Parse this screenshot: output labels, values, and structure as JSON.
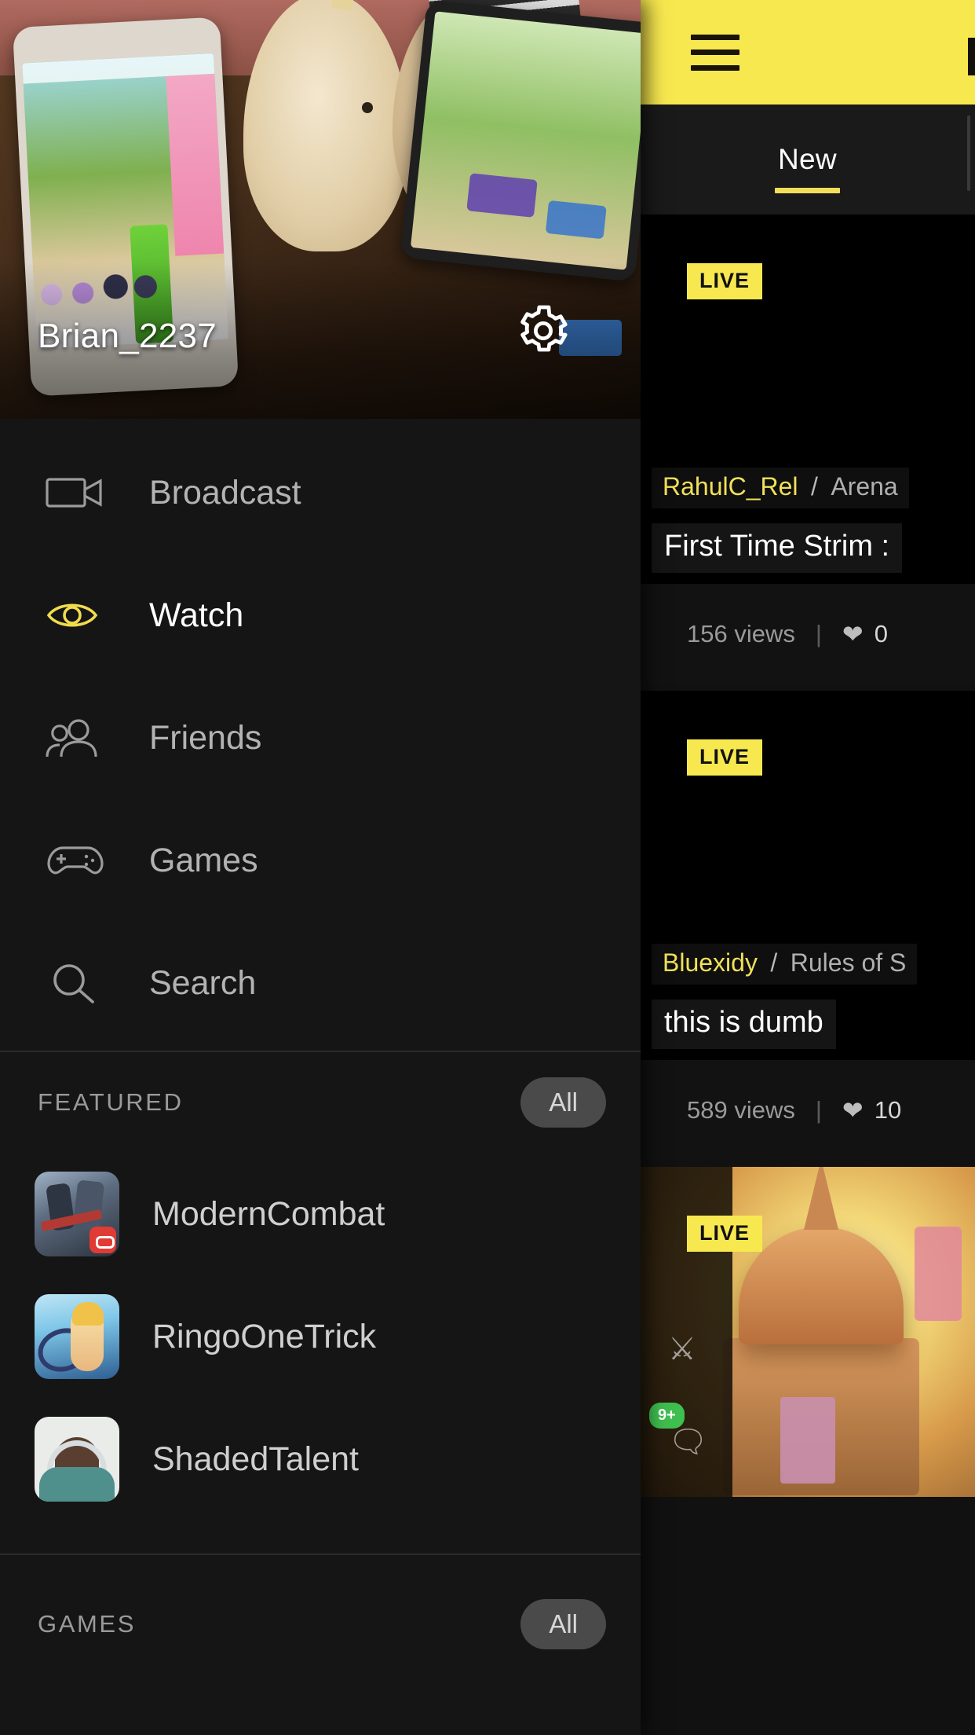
{
  "topbar": {
    "menu_icon": "hamburger-icon",
    "background": "#F8E84F"
  },
  "tabs": {
    "items": [
      {
        "label": "New",
        "active": true
      }
    ]
  },
  "drawer": {
    "profile": {
      "username": "Brian_2237",
      "settings_icon": "gear-icon"
    },
    "nav": [
      {
        "label": "Broadcast",
        "icon": "video-camera-icon",
        "active": false
      },
      {
        "label": "Watch",
        "icon": "eye-icon",
        "active": true
      },
      {
        "label": "Friends",
        "icon": "people-icon",
        "active": false
      },
      {
        "label": "Games",
        "icon": "gamepad-icon",
        "active": false
      },
      {
        "label": "Search",
        "icon": "search-icon",
        "active": false
      }
    ],
    "featured": {
      "title": "FEATURED",
      "all_label": "All",
      "items": [
        {
          "label": "ModernCombat"
        },
        {
          "label": "RingoOneTrick"
        },
        {
          "label": "ShadedTalent"
        }
      ]
    },
    "games": {
      "title": "GAMES",
      "all_label": "All"
    }
  },
  "feed": {
    "cards": [
      {
        "live_label": "LIVE",
        "user": "RahulC_Rel",
        "separator": "/",
        "game": "Arena",
        "title": "First Time Strim :",
        "views": "156 views",
        "stat_divider": "|",
        "heart_icon": "heart-icon",
        "likes": "0"
      },
      {
        "live_label": "LIVE",
        "user": "Bluexidy",
        "separator": "/",
        "game": "Rules of S",
        "title": "this is dumb",
        "views": "589 views",
        "stat_divider": "|",
        "heart_icon": "heart-icon",
        "likes": "10"
      },
      {
        "live_label": "LIVE",
        "hud_badge": "9+"
      }
    ]
  },
  "colors": {
    "accent_yellow": "#F8E84F",
    "tab_underline": "#F3DE5A",
    "user_name": "#F1E05A",
    "background": "#111111",
    "drawer_background": "#151515"
  }
}
